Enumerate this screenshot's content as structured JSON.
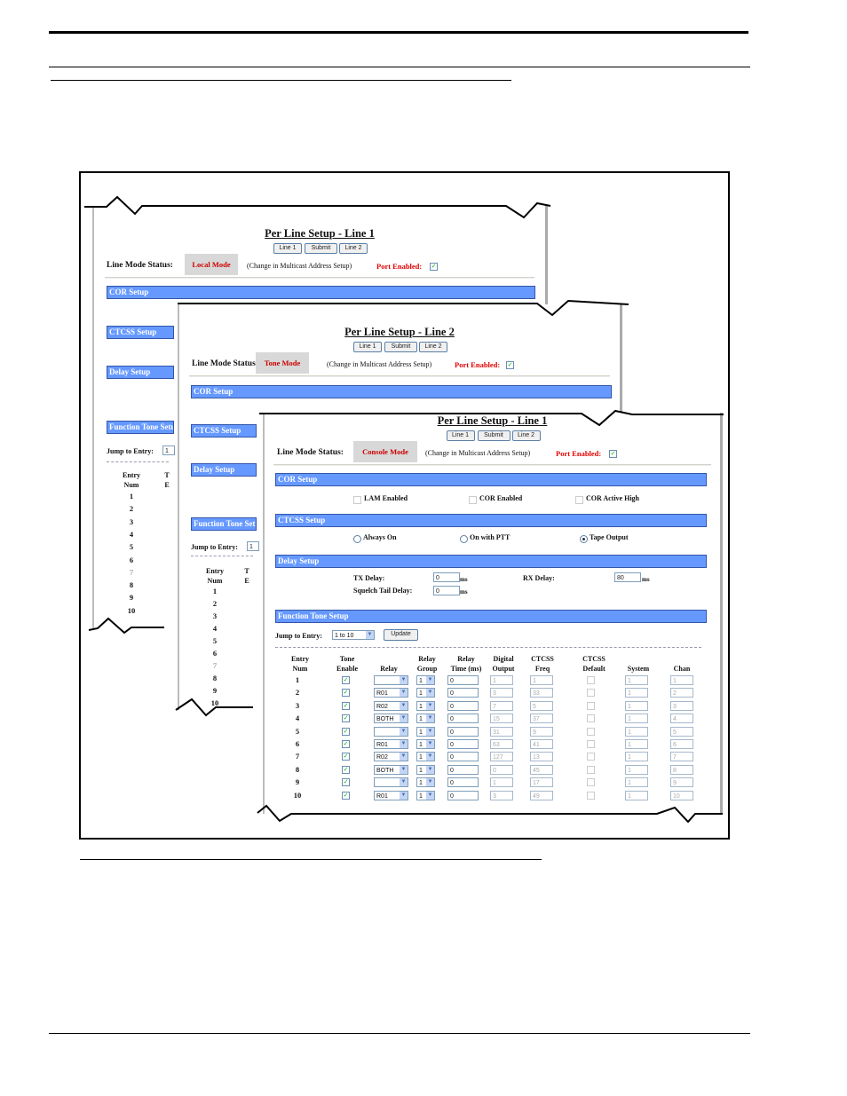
{
  "panels": [
    {
      "title": "Per Line Setup - Line 1",
      "buttons": [
        "Line 1",
        "Submit",
        "Line 2"
      ],
      "status_label": "Line Mode Status:",
      "mode": "Local Mode",
      "note": "(Change in Multicast Address Setup)",
      "port_label": "Port Enabled:",
      "port_enabled": true,
      "sections": [
        "COR Setup",
        "CTCSS Setup",
        "Delay Setup",
        "Function Tone Setup"
      ],
      "jump_label": "Jump to Entry:",
      "jump_value": "1",
      "entry_header": [
        "Entry",
        "Num"
      ],
      "col2_header": [
        "T",
        "E"
      ],
      "entries": [
        "1",
        "2",
        "3",
        "4",
        "5",
        "6",
        "7",
        "8",
        "9",
        "10"
      ]
    },
    {
      "title": "Per Line Setup - Line 2",
      "buttons": [
        "Line 1",
        "Submit",
        "Line 2"
      ],
      "status_label": "Line Mode Status:",
      "mode": "Tone Mode",
      "note": "(Change in Multicast Address Setup)",
      "port_label": "Port Enabled:",
      "port_enabled": true,
      "sections": [
        "COR Setup",
        "CTCSS Setup",
        "Delay Setup",
        "Function Tone Setup"
      ],
      "jump_label": "Jump to Entry:",
      "jump_value": "1",
      "entry_header": [
        "Entry",
        "Num"
      ],
      "col2_header": [
        "T",
        "E"
      ],
      "entries": [
        "1",
        "2",
        "3",
        "4",
        "5",
        "6",
        "7",
        "8",
        "9",
        "10"
      ]
    },
    {
      "title": "Per Line Setup - Line 1",
      "buttons": [
        "Line 1",
        "Submit",
        "Line 2"
      ],
      "status_label": "Line Mode Status:",
      "mode": "Console Mode",
      "note": "(Change in Multicast Address Setup)",
      "port_label": "Port Enabled:",
      "port_enabled": true,
      "sections": [
        "COR Setup",
        "CTCSS Setup",
        "Delay Setup",
        "Function Tone Setup"
      ],
      "cor_options": [
        {
          "label": "LAM Enabled",
          "checked": false
        },
        {
          "label": "COR Enabled",
          "checked": false
        },
        {
          "label": "COR Active High",
          "checked": false
        }
      ],
      "ctcss_options": [
        {
          "label": "Always On",
          "selected": false
        },
        {
          "label": "On with PTT",
          "selected": false
        },
        {
          "label": "Tape Output",
          "selected": true
        }
      ],
      "delay": {
        "tx_label": "TX Delay:",
        "tx_value": "0",
        "squelch_label": "Squelch Tail Delay:",
        "squelch_value": "0",
        "rx_label": "RX Delay:",
        "rx_value": "80",
        "unit": "ms"
      },
      "jump_label": "Jump to Entry:",
      "jump_value": "1 to 10",
      "update_label": "Update",
      "table_headers": [
        [
          "Entry",
          "Num"
        ],
        [
          "Tone",
          "Enable"
        ],
        [
          "",
          "Relay"
        ],
        [
          "Relay",
          "Group"
        ],
        [
          "Relay",
          "Time (ms)"
        ],
        [
          "Digital",
          "Output"
        ],
        [
          "CTCSS",
          "Freq"
        ],
        [
          "CTCSS",
          "Default"
        ],
        [
          "",
          "System"
        ],
        [
          "",
          "Chan"
        ]
      ],
      "rows": [
        {
          "entry": "1",
          "tone": true,
          "relay": "",
          "group": "1",
          "time": "0",
          "digital": "1",
          "freq": "1",
          "default": false,
          "system": "1",
          "chan": "1"
        },
        {
          "entry": "2",
          "tone": true,
          "relay": "R01",
          "group": "1",
          "time": "0",
          "digital": "3",
          "freq": "33",
          "default": false,
          "system": "1",
          "chan": "2"
        },
        {
          "entry": "3",
          "tone": true,
          "relay": "R02",
          "group": "1",
          "time": "0",
          "digital": "7",
          "freq": "5",
          "default": false,
          "system": "1",
          "chan": "3"
        },
        {
          "entry": "4",
          "tone": true,
          "relay": "BOTH",
          "group": "1",
          "time": "0",
          "digital": "15",
          "freq": "37",
          "default": false,
          "system": "1",
          "chan": "4"
        },
        {
          "entry": "5",
          "tone": true,
          "relay": "",
          "group": "1",
          "time": "0",
          "digital": "31",
          "freq": "9",
          "default": false,
          "system": "1",
          "chan": "5"
        },
        {
          "entry": "6",
          "tone": true,
          "relay": "R01",
          "group": "1",
          "time": "0",
          "digital": "63",
          "freq": "41",
          "default": false,
          "system": "1",
          "chan": "6"
        },
        {
          "entry": "7",
          "tone": true,
          "relay": "R02",
          "group": "1",
          "time": "0",
          "digital": "127",
          "freq": "13",
          "default": false,
          "system": "1",
          "chan": "7"
        },
        {
          "entry": "8",
          "tone": true,
          "relay": "BOTH",
          "group": "1",
          "time": "0",
          "digital": "0",
          "freq": "45",
          "default": false,
          "system": "1",
          "chan": "8"
        },
        {
          "entry": "9",
          "tone": true,
          "relay": "",
          "group": "1",
          "time": "0",
          "digital": "1",
          "freq": "17",
          "default": false,
          "system": "1",
          "chan": "9"
        },
        {
          "entry": "10",
          "tone": true,
          "relay": "R01",
          "group": "1",
          "time": "0",
          "digital": "3",
          "freq": "49",
          "default": false,
          "system": "1",
          "chan": "10"
        }
      ]
    }
  ],
  "colors": {
    "section_bar": "#6699ff",
    "mode_text": "#cc0000",
    "port_text": "#e00000",
    "mode_bg": "#d8d8d8"
  }
}
